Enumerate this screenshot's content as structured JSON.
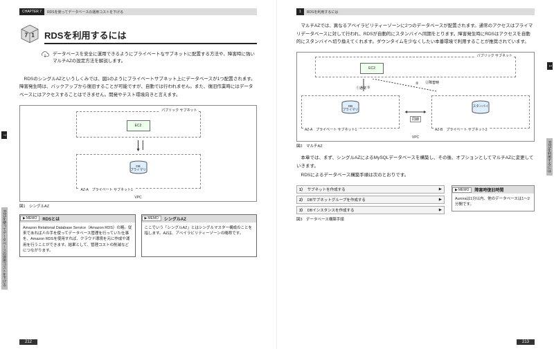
{
  "left": {
    "chapter_tag": "CHAPTER 7",
    "chapter_title": "RDSを使ってデータベースの運用コストを下げる",
    "chap_num": "7",
    "sec_num": "1",
    "sec_title": "RDSを利用するには",
    "intro": "データベースを安全に運用できるようにプライベートなサブネットに配置する方法や、障害時に強いマルチAZの設定方法を解説します。",
    "para1": "RDSのシングルAZというしくみでは、図1のようにプライベートサブネット上にデータベースが1つ配置されます。障害発生時は、バックアップから復旧することが可能ですが、自動では行われません。また、復旧作業時にはデータベースにはアクセスすることはできません。開発やテスト環境向きと言えます。",
    "diag1": {
      "pub_subnet": "パブリック サブネット",
      "ec2": "EC2",
      "priv_subnet": "AZ-A　プライベート サブネット1",
      "db": "DB",
      "db_sub": "プライマリ",
      "vpc": "VPC",
      "caption": "図1　シングルAZ"
    },
    "memo1": {
      "tag": "MEMO",
      "title": "RDSとは",
      "body": "Amazon Relational Database Service（Amazon RDS）の略。従来であれば人の手を使ってデータベース管理を行っていた仕事を、Amazon RDSを使用すれば、クラウド環境を元に作成や運用を行うことができます。結果として、管理コストの削減などにつながります。"
    },
    "memo2": {
      "tag": "MEMO",
      "title": "シングルAZ",
      "body": "ここでいう「シングルAZ」とはシングルマスター構成のことを指します。AZは、アベイラビリティーゾーンの略称です。"
    },
    "side_black": "7",
    "side_gray": "RDSを使ってデータベースの運用コストを下げる",
    "page_num": "212"
  },
  "right": {
    "header_left": "1",
    "header_title": "RDSを利用するには",
    "para1": "マルチAZでは、異なるアベイラビリティーゾーンに2つのデータベースが配置されます。通常のアクセスはプライマリデータベースに対して行われ、RDSが自動的にスタンバイへ同期をとります。障害発生時にRDSはアクセスを自動的にスタンバイへ切り換えてくれます。ダウンタイムを少なくしたい本番環境で利用することが推奨されています。",
    "diag2": {
      "pub_subnet": "パブリック サブネット",
      "ec2": "EC2",
      "step1": "①通常",
      "step2": "②障害時",
      "db1": "DB",
      "db1_sub": "プライマリ",
      "sync": "同期",
      "db2": "スタンバイ",
      "priv1": "AZ-A　プライベート サブネット1",
      "priv2": "AZ-B　プライベート サブネット2",
      "vpc": "VPC",
      "caption": "図2　マルチAZ"
    },
    "para2": "本章では、まず、シングルAZによるMySQLデータベースを構築し、その後、オプションとしてマルチAZに変更していきます。",
    "para3": "RDSによるデータベース構築手順は次のとおりです。",
    "steps": [
      {
        "n": "1）",
        "label": "サブネットを作成する"
      },
      {
        "n": "2）",
        "label": "DBサブネットグループを作成する"
      },
      {
        "n": "3）",
        "label": "DBインスタンスを作成する"
      }
    ],
    "steps_caption": "図3　データベース構築手順",
    "memo": {
      "tag": "MEMO",
      "title": "障害時復旧時間",
      "body": "Auroraは1分以内、他のデータベースは1〜2分間です。"
    },
    "side_black": "1",
    "side_gray": "RDSを利用するには",
    "page_num": "213"
  }
}
